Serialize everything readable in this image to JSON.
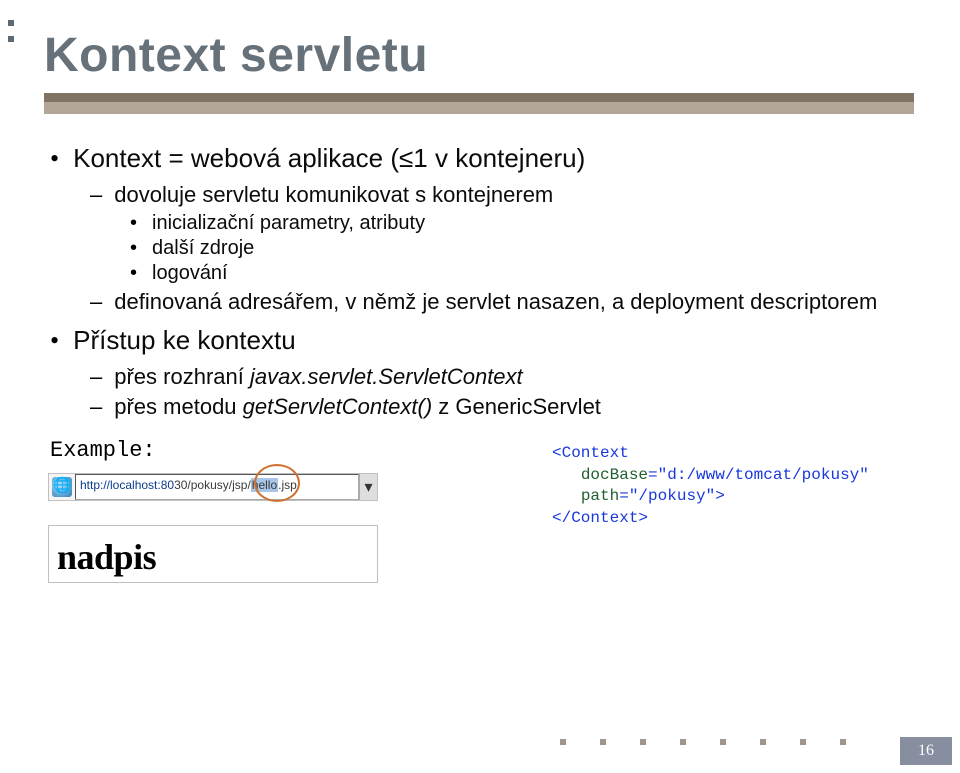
{
  "title": "Kontext servletu",
  "bullets": {
    "item1": "Kontext = webová aplikace (≤1 v kontejneru)",
    "item1_sub1": "dovoluje servletu komunikovat s kontejnerem",
    "item1_sub1_a": "inicializační parametry, atributy",
    "item1_sub1_b": "další zdroje",
    "item1_sub1_c": "logování",
    "item1_sub2": "definovaná adresářem, v němž je servlet nasazen, a deployment descriptorem",
    "item2": "Přístup ke kontextu",
    "item2_sub1_prefix": "přes rozhraní ",
    "item2_sub1_code": "javax.servlet.ServletContext",
    "item2_sub2_prefix": "přes metodu ",
    "item2_sub2_code": "getServletContext()",
    "item2_sub2_suffix": " z GenericServlet"
  },
  "example_label": "Example:",
  "url": {
    "scheme": "http://localhost:80",
    "mid": "30/pokusy/jsp/",
    "mid_hl": "hello",
    "tail": ".jsp",
    "dropdown_icon": "▾"
  },
  "nadpis": "nadpis",
  "xml": {
    "open_tag": "<Context",
    "attr1_name": "docBase",
    "attr1_val": "\"d:/www/tomcat/pokusy\"",
    "attr2_name": "path",
    "attr2_val": "\"/pokusy\"",
    "close1": ">",
    "close2": "</Context>"
  },
  "page_number": "16"
}
